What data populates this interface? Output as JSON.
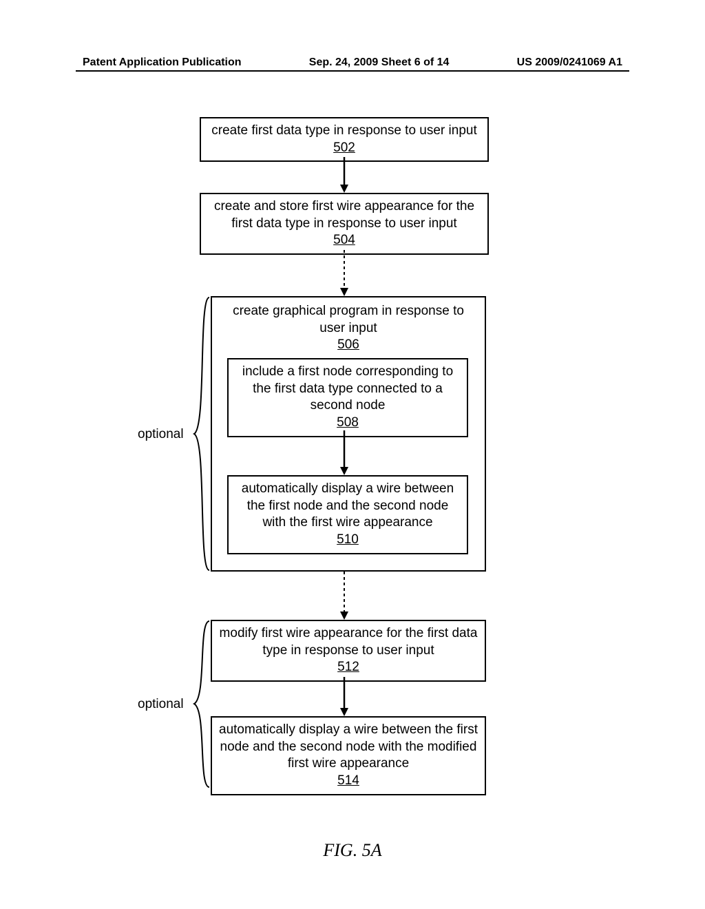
{
  "header": {
    "left": "Patent Application Publication",
    "mid": "Sep. 24, 2009  Sheet 6 of 14",
    "right": "US 2009/0241069 A1"
  },
  "boxes": {
    "b502": {
      "text": "create first data type in response to user input",
      "ref": "502"
    },
    "b504": {
      "text": "create and store first wire appearance for the first data type in response to user input",
      "ref": "504"
    },
    "b506": {
      "text": "create graphical program in response to user input",
      "ref": "506"
    },
    "b508": {
      "text": "include a first node corresponding to the first data type connected to a second node",
      "ref": "508"
    },
    "b510": {
      "text": "automatically display a wire between the first node and the second node with the first wire appearance",
      "ref": "510"
    },
    "b512": {
      "text": "modify first wire appearance for the first data type in response to user input",
      "ref": "512"
    },
    "b514": {
      "text": "automatically display a wire between the first node and the second node with the modified first wire appearance",
      "ref": "514"
    }
  },
  "labels": {
    "optional1": "optional",
    "optional2": "optional",
    "figure": "FIG. 5A"
  }
}
